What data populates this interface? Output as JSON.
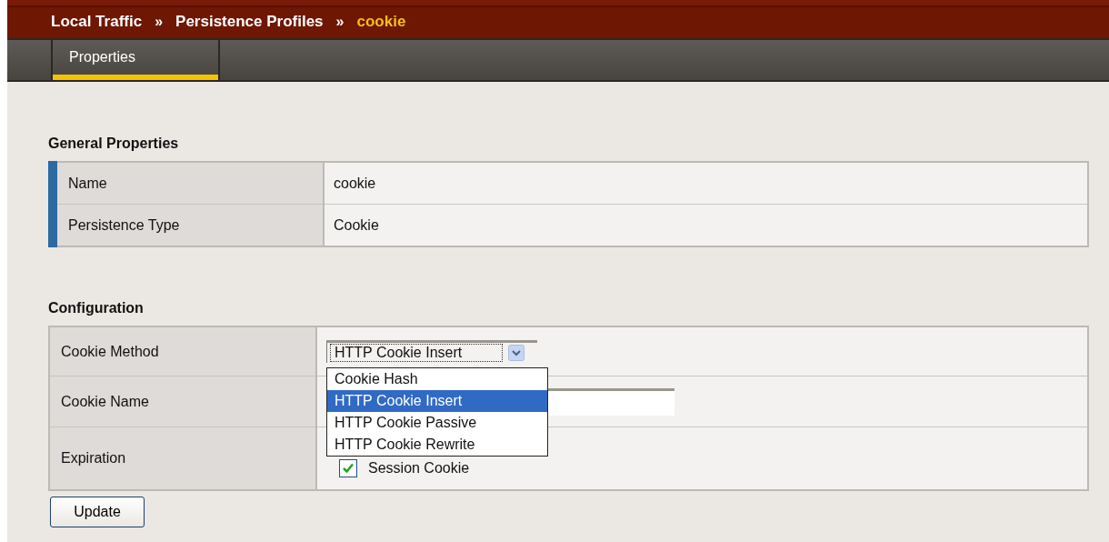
{
  "breadcrumb": [
    {
      "label": "Local Traffic",
      "current": false
    },
    {
      "label": "Persistence Profiles",
      "current": false
    },
    {
      "label": "cookie",
      "current": true
    }
  ],
  "breadcrumb_separator": "»",
  "tabs": [
    {
      "label": "Properties",
      "selected": true
    }
  ],
  "general_properties": {
    "title": "General Properties",
    "rows": [
      {
        "label": "Name",
        "value": "cookie"
      },
      {
        "label": "Persistence Type",
        "value": "Cookie"
      }
    ]
  },
  "configuration": {
    "title": "Configuration",
    "rows": [
      {
        "kind": "select",
        "label": "Cookie Method",
        "value": "HTTP Cookie Insert",
        "expanded": true,
        "options": [
          {
            "label": "Cookie Hash",
            "selected": false
          },
          {
            "label": "HTTP Cookie Insert",
            "selected": true
          },
          {
            "label": "HTTP Cookie Passive",
            "selected": false
          },
          {
            "label": "HTTP Cookie Rewrite",
            "selected": false
          }
        ]
      },
      {
        "kind": "text",
        "label": "Cookie Name"
      },
      {
        "kind": "checkbox",
        "label": "Expiration",
        "checked": true,
        "option_label": "Session Cookie"
      }
    ]
  },
  "buttons": [
    "Update"
  ]
}
